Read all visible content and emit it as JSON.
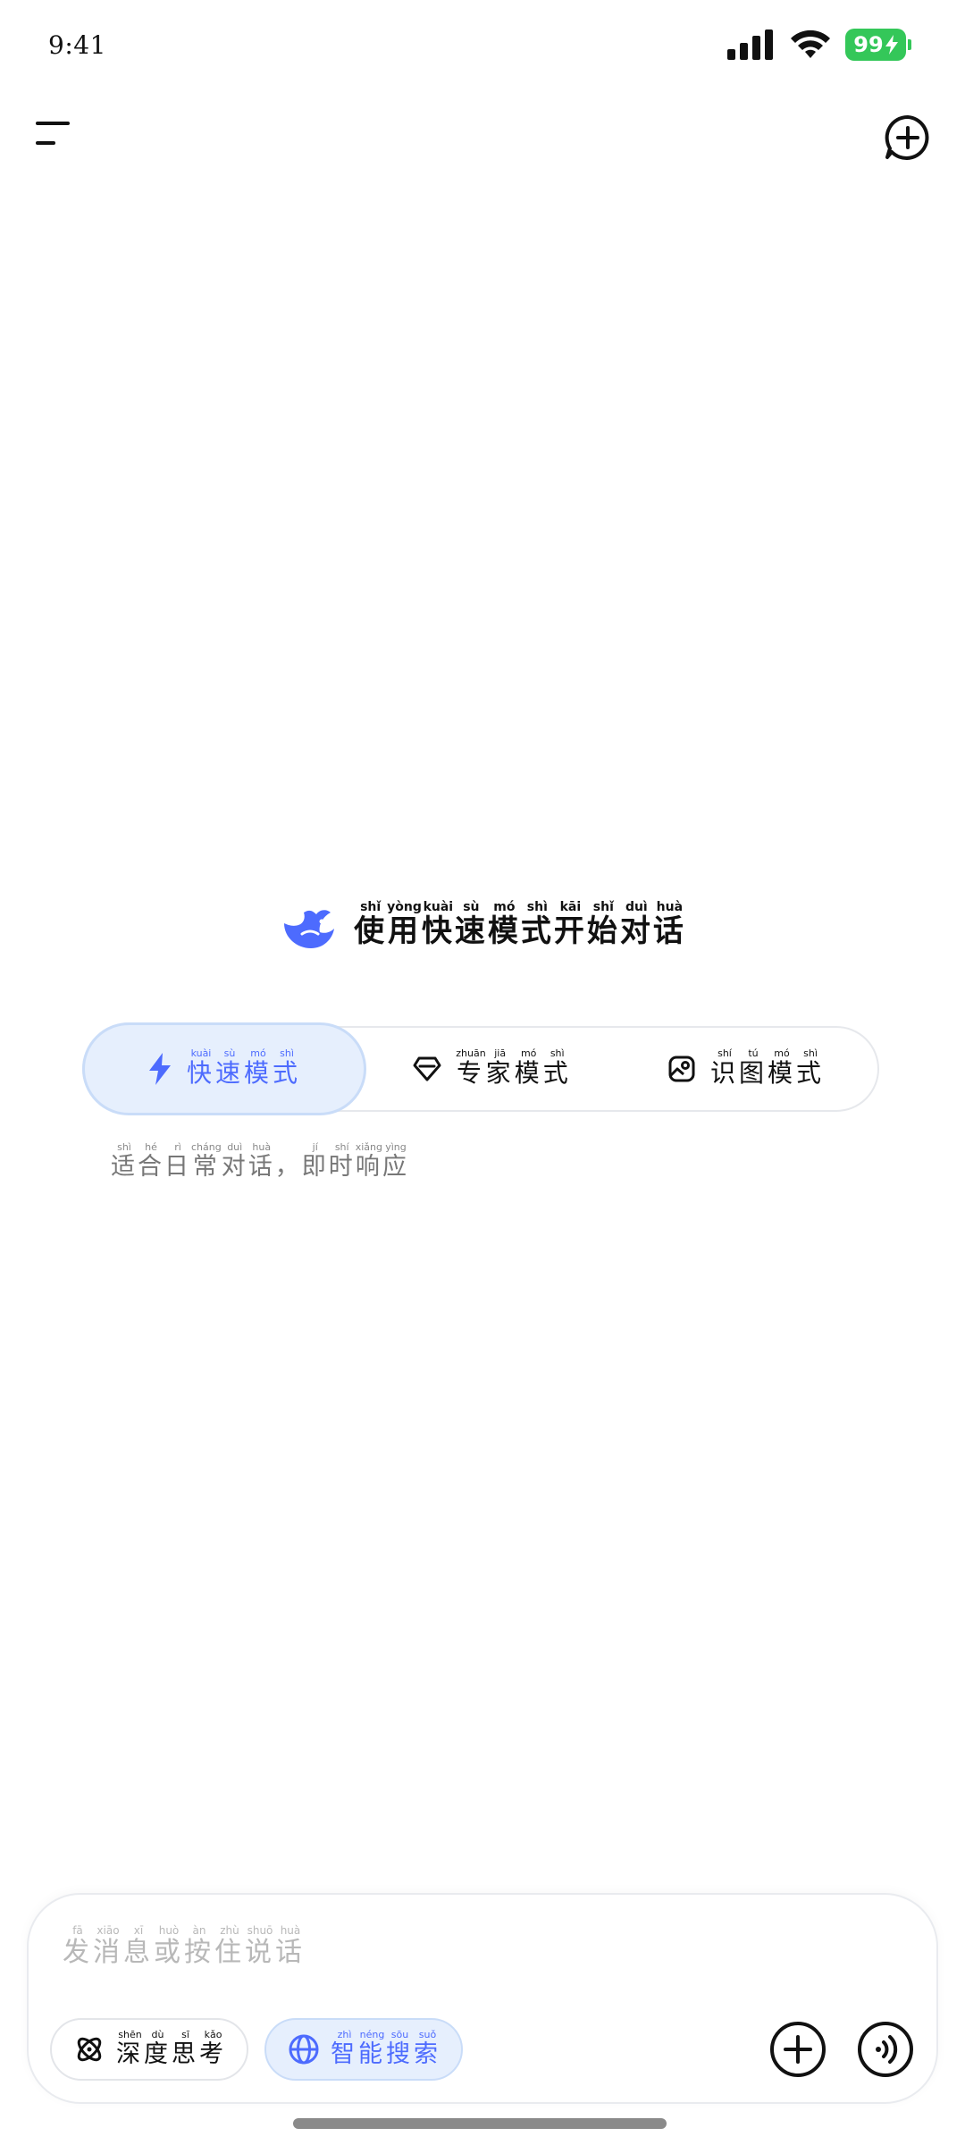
{
  "status_bar": {
    "time": "9:41",
    "battery": "99"
  },
  "hero": {
    "title_chars": [
      {
        "char": "使",
        "pinyin": "shǐ"
      },
      {
        "char": "用",
        "pinyin": "yòng"
      },
      {
        "char": "快",
        "pinyin": "kuài"
      },
      {
        "char": "速",
        "pinyin": "sù"
      },
      {
        "char": "模",
        "pinyin": "mó"
      },
      {
        "char": "式",
        "pinyin": "shì"
      },
      {
        "char": "开",
        "pinyin": "kāi"
      },
      {
        "char": "始",
        "pinyin": "shǐ"
      },
      {
        "char": "对",
        "pinyin": "duì"
      },
      {
        "char": "话",
        "pinyin": "huà"
      }
    ]
  },
  "modes": [
    {
      "id": "fast",
      "icon": "lightning-icon",
      "active": true,
      "chars": [
        {
          "char": "快",
          "pinyin": "kuài"
        },
        {
          "char": "速",
          "pinyin": "sù"
        },
        {
          "char": "模",
          "pinyin": "mó"
        },
        {
          "char": "式",
          "pinyin": "shì"
        }
      ]
    },
    {
      "id": "expert",
      "icon": "diamond-icon",
      "active": false,
      "chars": [
        {
          "char": "专",
          "pinyin": "zhuān"
        },
        {
          "char": "家",
          "pinyin": "jiā"
        },
        {
          "char": "模",
          "pinyin": "mó"
        },
        {
          "char": "式",
          "pinyin": "shì"
        }
      ]
    },
    {
      "id": "vision",
      "icon": "image-icon",
      "active": false,
      "chars": [
        {
          "char": "识",
          "pinyin": "shí"
        },
        {
          "char": "图",
          "pinyin": "tú"
        },
        {
          "char": "模",
          "pinyin": "mó"
        },
        {
          "char": "式",
          "pinyin": "shì"
        }
      ]
    }
  ],
  "mode_description": [
    {
      "char": "适",
      "pinyin": "shì"
    },
    {
      "char": "合",
      "pinyin": "hé"
    },
    {
      "char": "日",
      "pinyin": "rì"
    },
    {
      "char": "常",
      "pinyin": "cháng"
    },
    {
      "char": "对",
      "pinyin": "duì"
    },
    {
      "char": "话",
      "pinyin": "huà"
    },
    {
      "char": "，",
      "pinyin": ""
    },
    {
      "char": "即",
      "pinyin": "jí"
    },
    {
      "char": "时",
      "pinyin": "shí"
    },
    {
      "char": "响",
      "pinyin": "xiǎng"
    },
    {
      "char": "应",
      "pinyin": "yìng"
    }
  ],
  "composer": {
    "placeholder_chars": [
      {
        "char": "发",
        "pinyin": "fā"
      },
      {
        "char": "消",
        "pinyin": "xiāo"
      },
      {
        "char": "息",
        "pinyin": "xī"
      },
      {
        "char": "或",
        "pinyin": "huò"
      },
      {
        "char": "按",
        "pinyin": "àn"
      },
      {
        "char": "住",
        "pinyin": "zhù"
      },
      {
        "char": "说",
        "pinyin": "shuō"
      },
      {
        "char": "话",
        "pinyin": "huà"
      }
    ],
    "deep_think_chars": [
      {
        "char": "深",
        "pinyin": "shēn"
      },
      {
        "char": "度",
        "pinyin": "dù"
      },
      {
        "char": "思",
        "pinyin": "sī"
      },
      {
        "char": "考",
        "pinyin": "kǎo"
      }
    ],
    "smart_search_chars": [
      {
        "char": "智",
        "pinyin": "zhì"
      },
      {
        "char": "能",
        "pinyin": "néng"
      },
      {
        "char": "搜",
        "pinyin": "sōu"
      },
      {
        "char": "索",
        "pinyin": "suǒ"
      }
    ]
  },
  "colors": {
    "accent": "#4d6bfe",
    "active_bg": "#e6effd",
    "active_border": "#c9dcf8",
    "battery": "#34c759",
    "muted_text": "#777777",
    "placeholder": "#b8b8b8"
  }
}
